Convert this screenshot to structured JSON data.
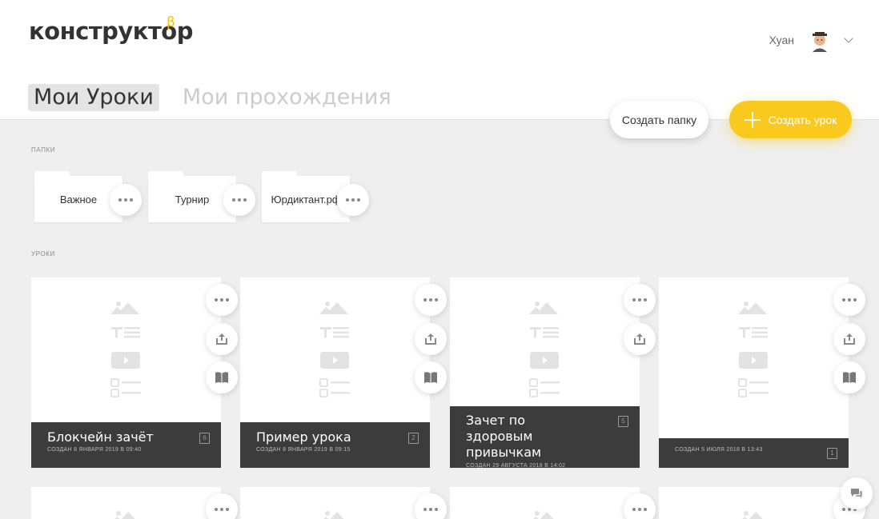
{
  "header": {
    "logo": "конструктор",
    "logo_sup": "β",
    "user_name": "Хуан"
  },
  "tabs": [
    {
      "label": "Мои Уроки",
      "active": true
    },
    {
      "label": "Мои прохождения",
      "active": false
    }
  ],
  "actions": {
    "create_folder": "Создать папку",
    "create_lesson": "Создать урок"
  },
  "sections": {
    "folders_label": "ПАПКИ",
    "lessons_label": "УРОКИ"
  },
  "folders": [
    {
      "name": "Важное"
    },
    {
      "name": "Турнир"
    },
    {
      "name": "Юрдиктант.рф"
    }
  ],
  "lessons": [
    {
      "title": "Блокчейн зачёт",
      "date": "СОЗДАН 8 ЯНВАРЯ 2019 В 09:40",
      "count": "6"
    },
    {
      "title": "Пример урока",
      "date": "СОЗДАН 8 ЯНВАРЯ 2019 В 09:15",
      "count": "2"
    },
    {
      "title": "Зачет по здоровым привычкам",
      "date": "СОЗДАН 29 АВГУСТА 2018 В 14:02",
      "count": "5"
    },
    {
      "title": "",
      "date": "СОЗДАН 5 ИЮЛЯ 2018 В 13:43",
      "count": "1"
    }
  ],
  "colors": {
    "accent": "#f9c91d",
    "card_footer": "#3c3c3c",
    "background": "#efefef"
  }
}
